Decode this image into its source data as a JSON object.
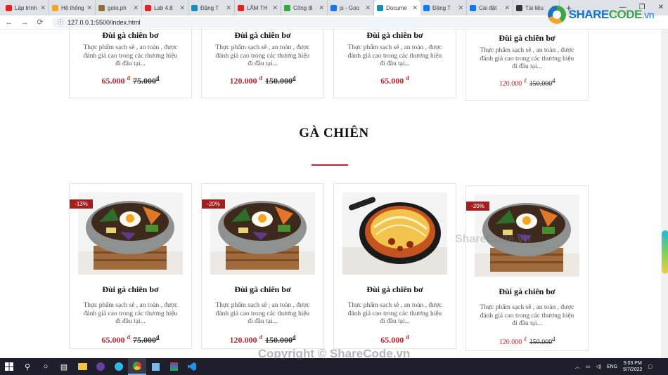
{
  "browser": {
    "tabs": [
      {
        "label": "Lập trình",
        "color": "#e02424"
      },
      {
        "label": "Hệ thống",
        "color": "#f2a52c"
      },
      {
        "label": "goto.ph",
        "color": "#8a6d3b"
      },
      {
        "label": "Lab 4.8",
        "color": "#e02424"
      },
      {
        "label": "Đặng T",
        "color": "#1b8ab5"
      },
      {
        "label": "LÂM TH",
        "color": "#e02424"
      },
      {
        "label": "Công đi",
        "color": "#3aa64a"
      },
      {
        "label": "js - Goo",
        "color": "#1a73e8"
      },
      {
        "label": "Docume",
        "color": "#1b8ab5",
        "active": true
      },
      {
        "label": "Đặng T",
        "color": "#1877f2"
      },
      {
        "label": "Cài đặt",
        "color": "#1a73e8"
      },
      {
        "label": "Tài liệu",
        "color": "#333333"
      }
    ],
    "url": "127.0.0.1:5500/index.html",
    "new_tab": "+",
    "back": "←",
    "forward": "→",
    "reload": "⟳"
  },
  "logo": {
    "share": "SHARE",
    "code": "CODE",
    "suffix": ".vn"
  },
  "top_cards": [
    {
      "title": "Đùi gà chiên bơ",
      "desc": "Thực phẩm sạch sẽ , an toàn , được đánh giá cao trong các thương hiệu đi đầu tại...",
      "price": "65.000",
      "old_price": "75.000",
      "currency": "đ"
    },
    {
      "title": "Đùi gà chiên bơ",
      "desc": "Thực phẩm sạch sẽ , an toàn , được đánh giá cao trong các thương hiệu đi đầu tại...",
      "price": "120.000",
      "old_price": "150.000",
      "currency": "đ"
    },
    {
      "title": "Đùi gà chiên bơ",
      "desc": "Thực phẩm sạch sẽ , an toàn , được đánh giá cao trong các thương hiệu đi đầu tại...",
      "price": "65.000",
      "old_price": "",
      "currency": "đ"
    },
    {
      "title": "Đùi gà chiên bơ",
      "desc": "Thực phẩm sạch sẽ , an toàn , được đánh giá cao trong các thương hiệu đi đầu tại...",
      "price": "120.000",
      "old_price": "150.000",
      "currency": "đ"
    }
  ],
  "section": {
    "title": "GÀ CHIÊN"
  },
  "bottom_cards": [
    {
      "badge": "-13%",
      "dish": "bibimbap",
      "title": "Đùi gà chiên bơ",
      "desc": "Thực phẩm sạch sẽ , an toàn , được đánh giá cao trong các thương hiệu đi đầu tại...",
      "price": "65.000",
      "old_price": "75.000",
      "currency": "đ"
    },
    {
      "badge": "-20%",
      "dish": "bibimbap",
      "title": "Đùi gà chiên bơ",
      "desc": "Thực phẩm sạch sẽ , an toàn , được đánh giá cao trong các thương hiệu đi đầu tại...",
      "price": "120.000",
      "old_price": "150.000",
      "currency": "đ"
    },
    {
      "badge": "",
      "dish": "skillet",
      "title": "Đùi gà chiên bơ",
      "desc": "Thực phẩm sạch sẽ , an toàn , được đánh giá cao trong các thương hiệu đi đầu tại...",
      "price": "65.000",
      "old_price": "",
      "currency": "đ"
    },
    {
      "badge": "-20%",
      "dish": "bibimbap",
      "title": "Đùi gà chiên bơ",
      "desc": "Thực phẩm sạch sẽ , an toàn , được đánh giá cao trong các thương hiệu đi đầu tại...",
      "price": "120.000",
      "old_price": "150.000",
      "currency": "đ"
    }
  ],
  "watermarks": {
    "center": "ShareCode.vn",
    "bottom": "Copyright © ShareCode.vn"
  },
  "taskbar": {
    "lang": "ENG",
    "time": "5:03 PM",
    "date": "5/7/2022"
  },
  "colors": {
    "accent": "#c0252f",
    "badge": "#a51e1e"
  }
}
